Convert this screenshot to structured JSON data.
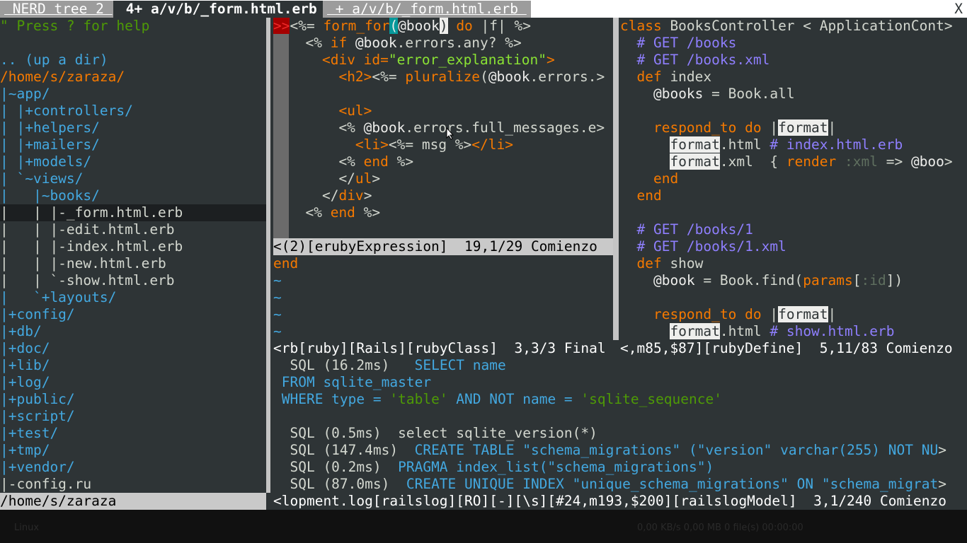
{
  "tabs": {
    "tab1": " NERD tree 2 ",
    "tab2": " 4+ a/v/b/_form.html.erb ",
    "tab3": " + a/v/b/_form.html.erb ",
    "close": "X"
  },
  "nerdtree": {
    "lines": [
      "\" Press ? for help",
      "",
      ".. (up a dir)",
      "/home/s/zaraza/",
      "|~app/",
      "| |+controllers/",
      "| |+helpers/",
      "| |+mailers/",
      "| |+models/",
      "| `~views/",
      "|   |~books/",
      "|   | |-_form.html.erb",
      "|   | |-edit.html.erb",
      "|   | |-index.html.erb",
      "|   | |-new.html.erb",
      "|   | `-show.html.erb",
      "|   `+layouts/",
      "|+config/",
      "|+db/",
      "|+doc/",
      "|+lib/",
      "|+log/",
      "|+public/",
      "|+script/",
      "|+test/",
      "|+tmp/",
      "|+vendor/",
      "|-config.ru"
    ],
    "status": "/home/s/zaraza"
  },
  "form_pane": {
    "sign": ">>",
    "l1": {
      "a": "<%= ",
      "b": "form_for",
      "c": "(",
      "d": "@book",
      "e": ")",
      "f": " do ",
      "g": "|f| %>"
    },
    "l2": {
      "a": "  <% ",
      "b": "if",
      "c": " @book",
      "d": ".errors.any? %>"
    },
    "l3": {
      "a": "    ",
      "b": "<div",
      "c": " id=",
      "d": "\"error_explanation\"",
      "e": ">"
    },
    "l4": {
      "a": "      ",
      "b": "<h2>",
      "c": "<%= ",
      "d": "pluralize",
      "e": "(",
      "f": "@book",
      "g": ".errors.",
      "h": ">"
    },
    "l5": "",
    "l6": {
      "a": "      ",
      "b": "<ul>"
    },
    "l7": {
      "a": "      <% ",
      "b": "@book",
      "c": ".errors.full_messages.e",
      "d": ">"
    },
    "l8": {
      "a": "        ",
      "b": "<li>",
      "c": "<%= msg %>",
      "d": "</li>"
    },
    "l9": {
      "a": "      <% ",
      "b": "end",
      "c": " %>"
    },
    "l10": {
      "a": "      </",
      "b": "ul",
      "c": ">"
    },
    "l11": {
      "a": "    </",
      "b": "div",
      "c": ">"
    },
    "l12": {
      "a": "  <% ",
      "b": "end",
      "c": " %>"
    },
    "status": "<(2)[erubyExpression]  19,1/29 Comienzo"
  },
  "small_pane": {
    "l1": "end",
    "tildes": [
      "~",
      "~",
      "~",
      "~"
    ],
    "status": "<rb[ruby][Rails][rubyClass]  3,3/3 Final"
  },
  "controller_pane": {
    "l1": {
      "a": "class",
      "b": " BooksController < ApplicationCont",
      "c": ">"
    },
    "l2": "  # GET /books",
    "l3": "  # GET /books.xml",
    "l4": {
      "a": "  def",
      "b": " index"
    },
    "l5": {
      "a": "    ",
      "b": "@books",
      "c": " = Book.all"
    },
    "l6": "",
    "l7": {
      "a": "    ",
      "b": "respond_to",
      "c": " do ",
      "d": "|",
      "e": "format",
      "f": "|"
    },
    "l8": {
      "a": "      ",
      "b": "format",
      "c": ".html ",
      "d": "# index.html.erb"
    },
    "l9": {
      "a": "      ",
      "b": "format",
      "c": ".xml  { ",
      "d": "render",
      "e": " :xml",
      "f": " => ",
      "g": "@boo",
      "h": ">"
    },
    "l10": {
      "a": "    ",
      "b": "end"
    },
    "l11": {
      "a": "  ",
      "b": "end"
    },
    "l12": "",
    "l13": "  # GET /books/1",
    "l14": "  # GET /books/1.xml",
    "l15": {
      "a": "  def",
      "b": " show"
    },
    "l16": {
      "a": "    ",
      "b": "@book",
      "c": " = Book.find(",
      "d": "params",
      "e": "[",
      "f": ":id",
      "g": "])"
    },
    "l17": "",
    "l18": {
      "a": "    ",
      "b": "respond_to",
      "c": " do ",
      "d": "|",
      "e": "format",
      "f": "|"
    },
    "l19": {
      "a": "      ",
      "b": "format",
      "c": ".html ",
      "d": "# show.html.erb"
    },
    "status": "<,m85,$87][rubyDefine]  5,11/83 Comienzo"
  },
  "log_pane": {
    "l1": {
      "a": "  SQL (16.2ms)   ",
      "b": "SELECT name"
    },
    "l2": " FROM sqlite_master",
    "l3": {
      "a": " WHERE type = ",
      "b": "'table'",
      "c": " AND NOT name = ",
      "d": "'sqlite_sequence'"
    },
    "l4": "",
    "l5": "  SQL (0.5ms)  select sqlite_version(*)",
    "l6": {
      "a": "  SQL (147.4ms)  ",
      "b": "CREATE TABLE \"schema_migrations\" (\"version\" varchar(255) NOT NU",
      "c": ">"
    },
    "l7": {
      "a": "  SQL (0.2ms)  ",
      "b": "PRAGMA index_list(\"schema_migrations\")"
    },
    "l8": {
      "a": "  SQL (87.0ms)  ",
      "b": "CREATE UNIQUE INDEX \"unique_schema_migrations\" ON \"schema_migrat",
      "c": ">"
    },
    "status": "<lopment.log[railslog][RO][-][\\s][#24,m193,$200][railslogModel]  3,1/240 Comienzo"
  },
  "taskbar": {
    "left": "Linux",
    "right": "0,00 KB/s   0,00 MB   0 file(s)   00:00:00"
  }
}
